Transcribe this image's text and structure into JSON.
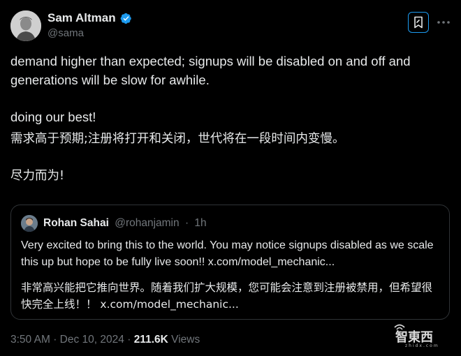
{
  "author": {
    "name": "Sam Altman",
    "handle": "@sama",
    "verified": true
  },
  "header_actions": {
    "grok_icon": "grok-bookmark-icon",
    "more_icon": "more-dots-icon"
  },
  "post": {
    "line1": "demand higher than expected; signups will be disabled on and off and generations will be slow for awhile.",
    "line2": "doing our best!",
    "line3": "需求高于预期;注册将打开和关闭，世代将在一段时间内变慢。",
    "line4": "尽力而为!"
  },
  "quote": {
    "name": "Rohan Sahai",
    "handle": "@rohanjamin",
    "separator": "·",
    "time": "1h",
    "text_en": "Very excited to bring this to the world. You may notice signups disabled as we scale this up but hope to be fully live soon!! x.com/model_mechanic...",
    "text_zh": "非常高兴能把它推向世界。随着我们扩大规模，您可能会注意到注册被禁用，但希望很快完全上线！！ x.com/model_mechanic..."
  },
  "footer": {
    "time": "3:50 AM",
    "separator": "·",
    "date": "Dec 10, 2024",
    "views_count": "211.6K",
    "views_label": "Views"
  },
  "watermark": {
    "text": "智東西",
    "sub": "zhidx.com"
  },
  "colors": {
    "background": "#000000",
    "text": "#e7e9ea",
    "muted": "#71767b",
    "accent": "#1d9bf0",
    "border": "#2f3336"
  }
}
